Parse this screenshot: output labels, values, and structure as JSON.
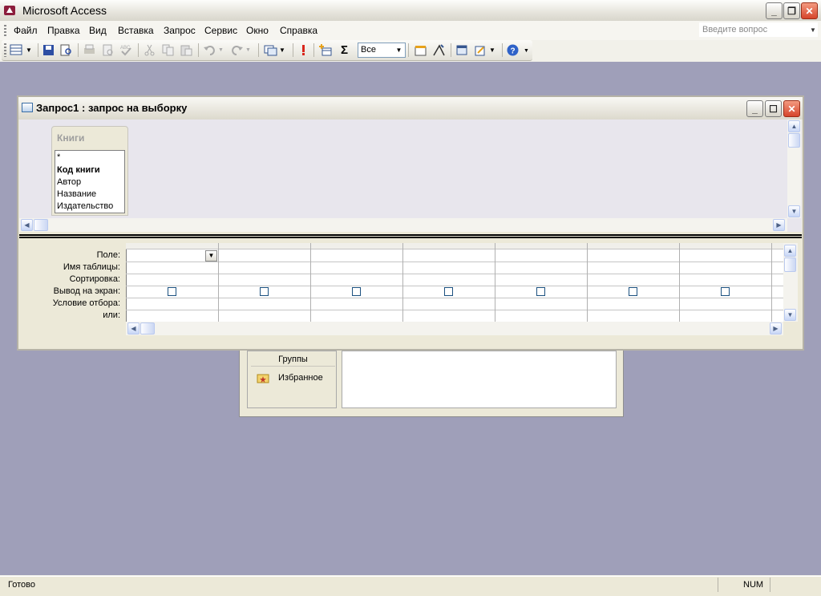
{
  "app": {
    "title": "Microsoft Access"
  },
  "menubar": {
    "items": [
      {
        "label": "Файл"
      },
      {
        "label": "Правка"
      },
      {
        "label": "Вид"
      },
      {
        "label": "Вставка"
      },
      {
        "label": "Запрос"
      },
      {
        "label": "Сервис"
      },
      {
        "label": "Окно"
      },
      {
        "label": "Справка"
      }
    ],
    "question_placeholder": "Введите вопрос"
  },
  "toolbar": {
    "top_values_select": "Все",
    "icons": [
      "view-icon",
      "save-icon",
      "search-file-icon",
      "print-icon",
      "print-preview-icon",
      "spelling-icon",
      "cut-icon",
      "copy-icon",
      "paste-icon",
      "undo-icon",
      "redo-icon",
      "query-type-icon",
      "run-icon",
      "show-table-icon",
      "totals-icon",
      "properties-icon",
      "builder-icon",
      "database-window-icon",
      "new-object-icon",
      "help-icon"
    ]
  },
  "query_window": {
    "title": "Запрос1 : запрос на выборку",
    "field_list": {
      "title": "Книги",
      "fields": [
        "*",
        "Код книги",
        "Автор",
        "Название",
        "Издательство"
      ]
    },
    "grid": {
      "row_labels": [
        "Поле:",
        "Имя таблицы:",
        "Сортировка:",
        "Вывод на экран:",
        "Условие отбора:",
        "или:"
      ],
      "column_count": 7
    }
  },
  "background_window": {
    "groups_label": "Группы",
    "favorites_label": "Избранное"
  },
  "statusbar": {
    "text": "Готово",
    "num": "NUM"
  },
  "colors": {
    "mdi_background": "#9f9fb9",
    "pane_background": "#e8e6ed"
  }
}
